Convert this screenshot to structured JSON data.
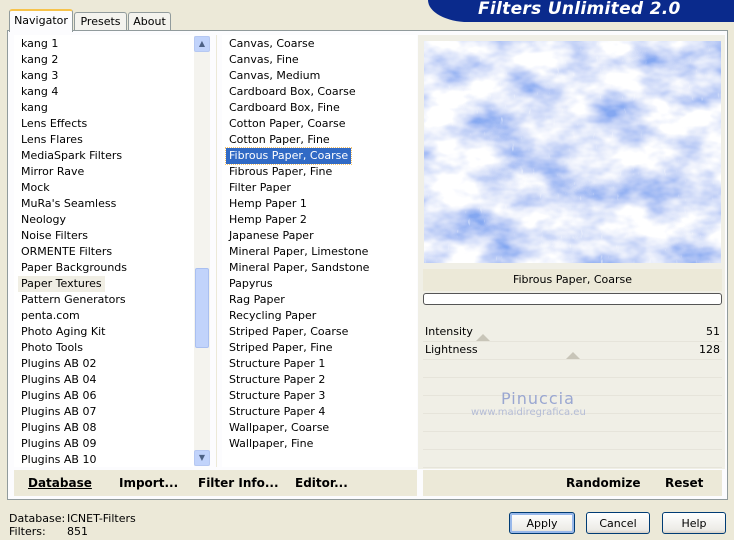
{
  "header": {
    "title": "Filters Unlimited 2.0"
  },
  "tabs": [
    {
      "label": "Navigator",
      "active": true
    },
    {
      "label": "Presets",
      "active": false
    },
    {
      "label": "About",
      "active": false
    }
  ],
  "categories": [
    "kang 1",
    "kang 2",
    "kang 3",
    "kang 4",
    "kang",
    "Lens Effects",
    "Lens Flares",
    "MediaSpark Filters",
    "Mirror Rave",
    "Mock",
    "MuRa's Seamless",
    "Neology",
    "Noise Filters",
    "ORMENTE Filters",
    "Paper Backgrounds",
    "Paper Textures",
    "Pattern Generators",
    "penta.com",
    "Photo Aging Kit",
    "Photo Tools",
    "Plugins AB 02",
    "Plugins AB 04",
    "Plugins AB 06",
    "Plugins AB 07",
    "Plugins AB 08",
    "Plugins AB 09",
    "Plugins AB 10"
  ],
  "selected_category": "Paper Textures",
  "filters": [
    "Canvas, Coarse",
    "Canvas, Fine",
    "Canvas, Medium",
    "Cardboard Box, Coarse",
    "Cardboard Box, Fine",
    "Cotton Paper, Coarse",
    "Cotton Paper, Fine",
    "Fibrous Paper, Coarse",
    "Fibrous Paper, Fine",
    "Filter Paper",
    "Hemp Paper 1",
    "Hemp Paper 2",
    "Japanese Paper",
    "Mineral Paper, Limestone",
    "Mineral Paper, Sandstone",
    "Papyrus",
    "Rag Paper",
    "Recycling Paper",
    "Striped Paper, Coarse",
    "Striped Paper, Fine",
    "Structure Paper 1",
    "Structure Paper 2",
    "Structure Paper 3",
    "Structure Paper 4",
    "Wallpaper, Coarse",
    "Wallpaper, Fine"
  ],
  "selected_filter": "Fibrous Paper, Coarse",
  "preview": {
    "filter_name": "Fibrous Paper, Coarse"
  },
  "sliders": [
    {
      "label": "Intensity",
      "value": "51",
      "fraction": 0.2
    },
    {
      "label": "Lightness",
      "value": "128",
      "fraction": 0.5
    }
  ],
  "watermark": {
    "name": "Pinuccia",
    "site": "www.maidiregrafica.eu"
  },
  "left_buttons": {
    "database": "Database",
    "import": "Import...",
    "filter_info": "Filter Info...",
    "editor": "Editor..."
  },
  "right_buttons": {
    "randomize": "Randomize",
    "reset": "Reset"
  },
  "status": {
    "database_label": "Database:",
    "database_value": "ICNET-Filters",
    "filters_label": "Filters:",
    "filters_value": "851"
  },
  "dialog": {
    "apply": "Apply",
    "cancel": "Cancel",
    "help": "Help"
  },
  "colors": {
    "banner": "#0a2a8c",
    "selection": "#316ac5",
    "preview_blue": "#3a63e0"
  }
}
